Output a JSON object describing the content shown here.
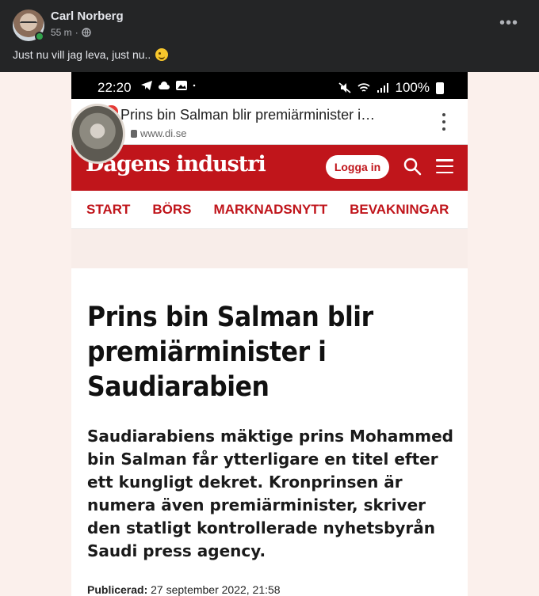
{
  "post": {
    "author": "Carl Norberg",
    "time": "55 m",
    "separator": "·",
    "privacy_icon": "globe-icon",
    "text": "Just nu vill jag leva, just nu..",
    "more_label": "•••",
    "emoji": "wink-emoji"
  },
  "status_bar": {
    "time": "22:20",
    "battery": "100%"
  },
  "browser": {
    "tab_badge": "1",
    "tab_title": "Prins bin Salman blir premiärminister i…",
    "url": "www.di.se"
  },
  "site": {
    "logo": "Dagens industri",
    "login_label": "Logga in",
    "brand_color": "#c0151b",
    "nav": [
      "START",
      "BÖRS",
      "MARKNADSNYTT",
      "BEVAKNINGAR"
    ]
  },
  "article": {
    "headline": "Prins bin Salman blir premiärminister i Saudiarabien",
    "lead": "Saudiarabiens mäktige prins Mohammed bin Salman får ytterligare en titel efter ett kungligt dekret. Kronprinsen är numera även premiärminister, skriver den statligt kontrollerade nyhetsbyrån Saudi press agency.",
    "published_label": "Publicerad:",
    "published_value": "27 september 2022, 21:58"
  }
}
